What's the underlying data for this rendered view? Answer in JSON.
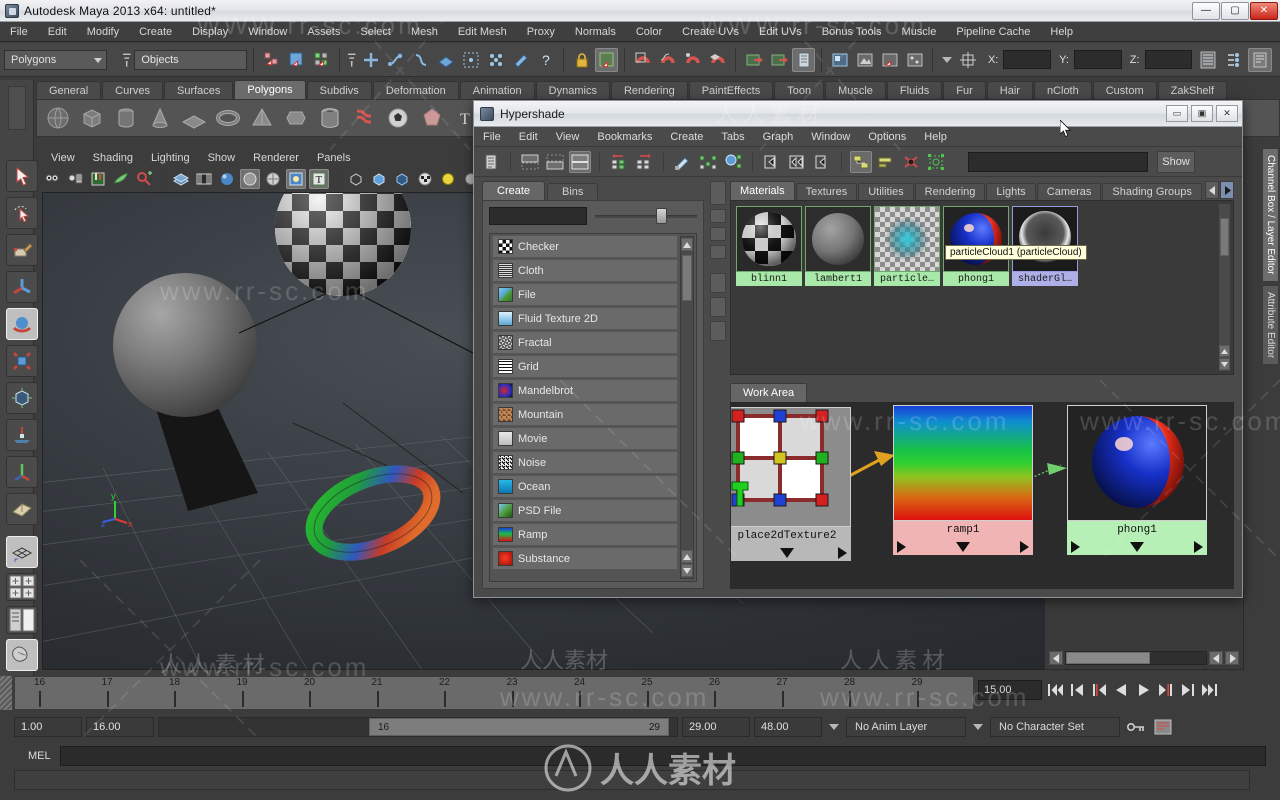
{
  "window": {
    "title": "Autodesk Maya 2013 x64: untitled*",
    "minimize": "—",
    "maximize": "▢",
    "close": "✕"
  },
  "menubar": {
    "items": [
      "File",
      "Edit",
      "Modify",
      "Create",
      "Display",
      "Window",
      "Assets",
      "Select",
      "Mesh",
      "Edit Mesh",
      "Proxy",
      "Normals",
      "Color",
      "Create UVs",
      "Edit UVs",
      "Bonus Tools",
      "Muscle",
      "Pipeline Cache",
      "Help"
    ]
  },
  "statusbar": {
    "mode_select": "Polygons",
    "object_field": "Objects",
    "x_label": "X:",
    "y_label": "Y:",
    "z_label": "Z:",
    "x_value": "",
    "y_value": "",
    "z_value": ""
  },
  "shelf": {
    "tabs": [
      "General",
      "Curves",
      "Surfaces",
      "Polygons",
      "Subdivs",
      "Deformation",
      "Animation",
      "Dynamics",
      "Rendering",
      "PaintEffects",
      "Toon",
      "Muscle",
      "Fluids",
      "Fur",
      "Hair",
      "nCloth",
      "Custom",
      "ZakShelf"
    ],
    "active": "Polygons"
  },
  "viewport": {
    "menus": [
      "View",
      "Shading",
      "Lighting",
      "Show",
      "Renderer",
      "Panels"
    ],
    "axis": {
      "x": "x",
      "y": "y",
      "z": "z"
    }
  },
  "right_tabs": {
    "items": [
      "Channel Box / Layer Editor",
      "Attribute Editor"
    ],
    "active": "Channel Box / Layer Editor"
  },
  "timeline": {
    "ticks": [
      "16",
      "17",
      "18",
      "19",
      "20",
      "21",
      "22",
      "23",
      "24",
      "25",
      "26",
      "27",
      "28",
      "29"
    ],
    "current_time": "15.00",
    "transport": [
      "⏮",
      "|◀",
      "◀|",
      "◀",
      "▶",
      "|▶",
      "▶|",
      "⏭"
    ]
  },
  "range": {
    "start": "1.00",
    "range_start": "16.00",
    "slider_start": "16",
    "slider_end": "29",
    "range_end": "29.00",
    "end": "48.00",
    "anim_layer": "No Anim Layer",
    "character_set": "No Character Set"
  },
  "command_line": {
    "label": "MEL",
    "value": "",
    "help_value": ""
  },
  "hypershade": {
    "title": "Hypershade",
    "minimize": "▭",
    "maximize": "▣",
    "close": "✕",
    "menus": [
      "File",
      "Edit",
      "View",
      "Bookmarks",
      "Create",
      "Tabs",
      "Graph",
      "Window",
      "Options",
      "Help"
    ],
    "search_value": "",
    "show_button": "Show",
    "left_tabs": [
      "Create",
      "Bins"
    ],
    "left_active": "Create",
    "filter_value": "",
    "create_nodes": [
      {
        "label": "Checker",
        "swatch": "checker"
      },
      {
        "label": "Cloth",
        "swatch": "cloth"
      },
      {
        "label": "File",
        "swatch": "file"
      },
      {
        "label": "Fluid Texture 2D",
        "swatch": "fluid"
      },
      {
        "label": "Fractal",
        "swatch": "fractal"
      },
      {
        "label": "Grid",
        "swatch": "grid"
      },
      {
        "label": "Mandelbrot",
        "swatch": "mandelbrot"
      },
      {
        "label": "Mountain",
        "swatch": "mountain"
      },
      {
        "label": "Movie",
        "swatch": "movie"
      },
      {
        "label": "Noise",
        "swatch": "noise"
      },
      {
        "label": "Ocean",
        "swatch": "ocean"
      },
      {
        "label": "PSD File",
        "swatch": "psd"
      },
      {
        "label": "Ramp",
        "swatch": "ramp"
      },
      {
        "label": "Substance",
        "swatch": "substance"
      }
    ],
    "material_tabs": [
      "Materials",
      "Textures",
      "Utilities",
      "Rendering",
      "Lights",
      "Cameras",
      "Shading Groups"
    ],
    "material_tabs_active": "Materials",
    "swatches": [
      {
        "name": "blinn1",
        "type": "blinn",
        "selected": false
      },
      {
        "name": "lambert1",
        "type": "lambert",
        "selected": false
      },
      {
        "name": "particle…",
        "type": "particleCloud",
        "selected": false
      },
      {
        "name": "phong1",
        "type": "phong",
        "selected": false
      },
      {
        "name": "shaderGl…",
        "type": "shaderGlow",
        "selected": true
      }
    ],
    "tooltip": "particleCloud1 (particleCloud)",
    "work_area_tab": "Work Area",
    "work_nodes": [
      {
        "name": "place2dTexture2",
        "kind": "place2d"
      },
      {
        "name": "ramp1",
        "kind": "ramp"
      },
      {
        "name": "phong1",
        "kind": "phong"
      }
    ]
  }
}
